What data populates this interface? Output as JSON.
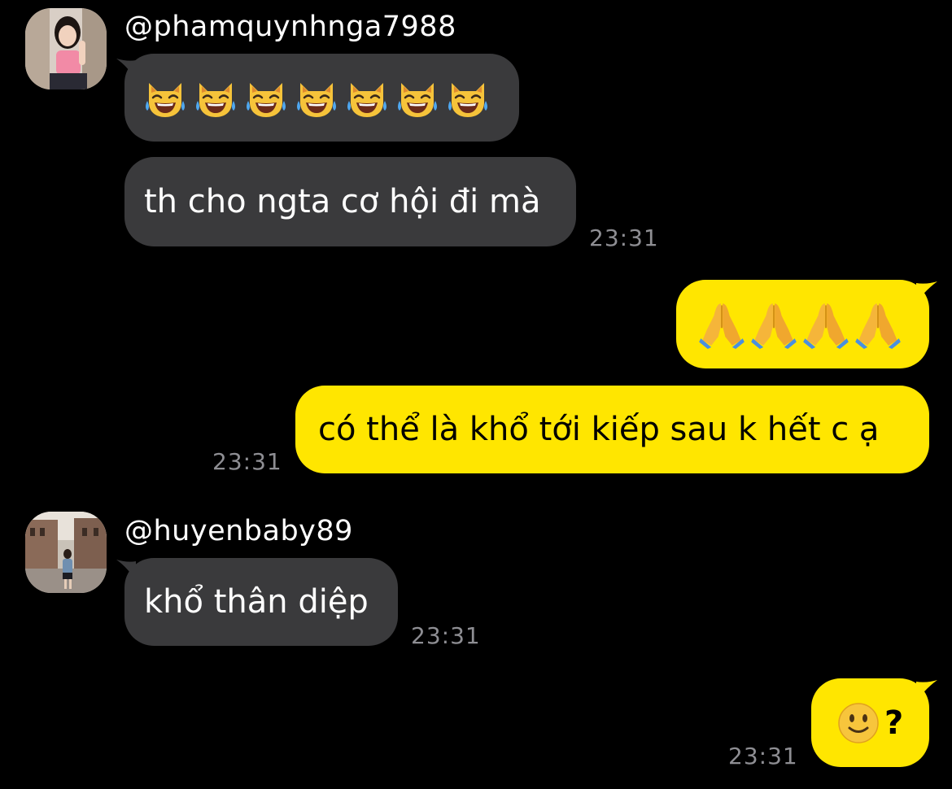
{
  "theme": {
    "background": "#000000",
    "incoming_bubble": "#3a3a3c",
    "outgoing_bubble": "#ffe600",
    "timestamp_color": "#8e8e93"
  },
  "messages": [
    {
      "direction": "incoming",
      "sender": "@phamquynhnga7988",
      "avatar": "avatar-photo-woman",
      "content_type": "emoji",
      "emoji": "crying-laughing-cat-emoji",
      "emoji_count": 7
    },
    {
      "direction": "incoming",
      "sender": "@phamquynhnga7988",
      "content_type": "text",
      "text": "th cho ngta cơ hội đi mà",
      "time": "23:31"
    },
    {
      "direction": "outgoing",
      "content_type": "emoji",
      "emoji": "folded-hands-emoji",
      "emoji_count": 4
    },
    {
      "direction": "outgoing",
      "content_type": "text",
      "text": "có thể là khổ tới kiếp sau k hết c ạ",
      "time": "23:31"
    },
    {
      "direction": "incoming",
      "sender": "@huyenbaby89",
      "avatar": "avatar-photo-street",
      "content_type": "text",
      "text": "khổ thân diệp",
      "time": "23:31"
    },
    {
      "direction": "outgoing",
      "content_type": "emoji-text",
      "emoji": "slightly-smiling-face-emoji",
      "text": "?",
      "time": "23:31"
    }
  ]
}
